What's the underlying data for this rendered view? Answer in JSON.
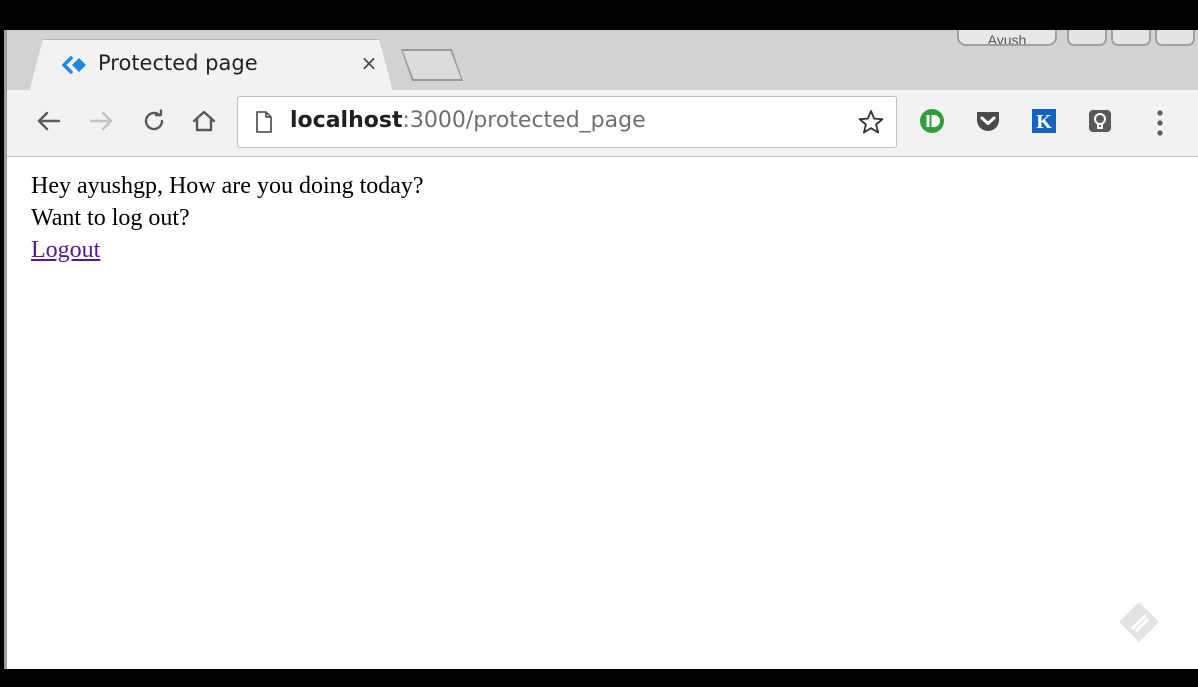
{
  "browser": {
    "tab": {
      "title": "Protected page",
      "close_label": "×"
    },
    "profile": {
      "name": "Ayush"
    },
    "address_bar": {
      "host": "localhost",
      "rest": ":3000/protected_page"
    },
    "icons": [
      "back-icon",
      "forward-icon",
      "reload-icon",
      "home-icon",
      "page-info-icon",
      "bookmark-star-icon",
      "ext-green-icon",
      "pocket-icon",
      "k-extension-icon",
      "bulb-extension-icon",
      "menu-icon"
    ],
    "extensions": {
      "k_label": "K"
    }
  },
  "page": {
    "greeting": "Hey ayushgp, How are you doing today?",
    "question": "Want to log out?",
    "logout_link": "Logout"
  },
  "colors": {
    "link": "#551a8b",
    "tab_icon": "#1e88e5",
    "green_ext": "#2e9d3a",
    "k_ext": "#1565c0"
  }
}
